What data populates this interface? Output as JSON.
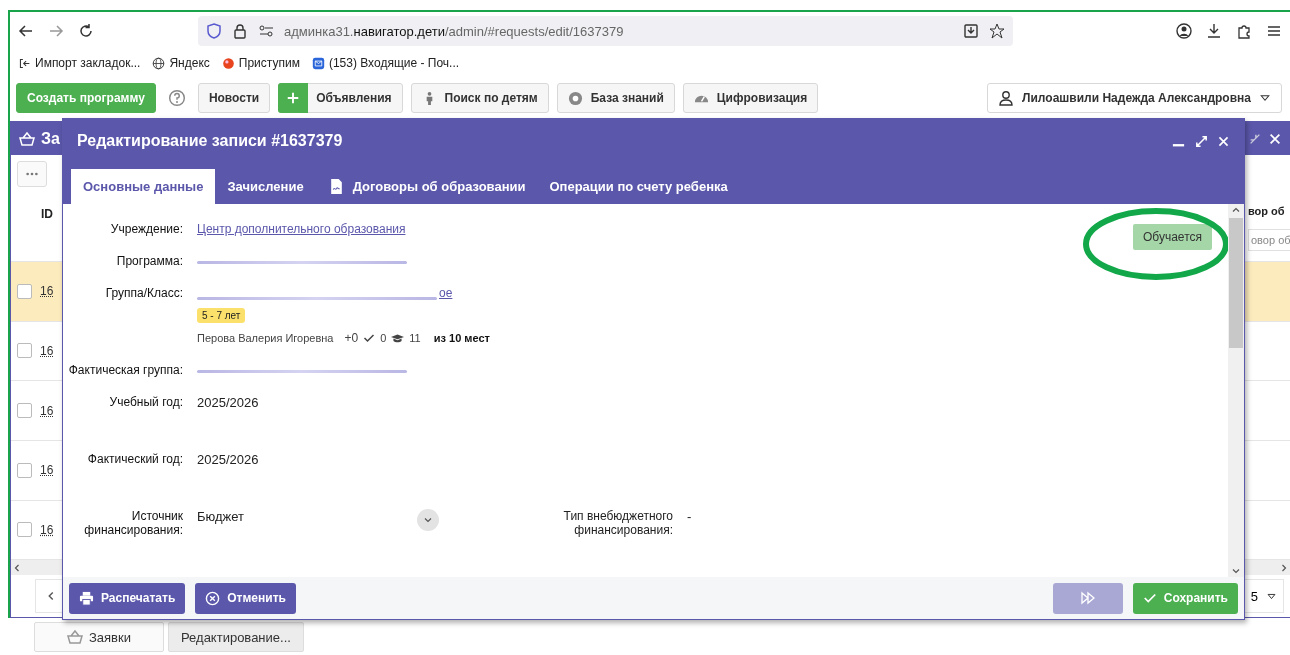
{
  "browser": {
    "url": "админка31.**навигатор.дети**/admin/#requests/edit/1637379",
    "bookmarks": [
      {
        "label": "Импорт закладок...",
        "kind": "import"
      },
      {
        "label": "Яндекс",
        "kind": "globe"
      },
      {
        "label": "Приступим",
        "kind": "dot"
      },
      {
        "label": "(153) Входящие - Поч...",
        "kind": "mail"
      }
    ]
  },
  "toolbar": {
    "buttons": [
      {
        "label": "Создать программу",
        "kind": "primary"
      },
      {
        "kind": "help"
      },
      {
        "label": "Новости",
        "kind": "plain"
      },
      {
        "label": "Объявления",
        "kind": "plus"
      },
      {
        "label": "Поиск по детям",
        "kind": "person"
      },
      {
        "label": "База знаний",
        "kind": "lifebuoy"
      },
      {
        "label": "Цифровизация",
        "kind": "gauge"
      }
    ],
    "user": "Лилоашвили Надежда Александровна"
  },
  "background_window": {
    "title": "За",
    "id_header": "ID",
    "column_header": "вор об",
    "filter_placeholder": "овор об",
    "page_size": "5",
    "rows": [
      {
        "id": "16",
        "selected": true
      },
      {
        "id": "16",
        "selected": false
      },
      {
        "id": "16",
        "selected": false
      },
      {
        "id": "16",
        "selected": false
      },
      {
        "id": "16",
        "selected": false
      }
    ]
  },
  "modal": {
    "title": "Редактирование записи #1637379",
    "tabs": [
      {
        "label": "Основные данные",
        "selected": true,
        "kind": "plain"
      },
      {
        "label": "Зачисление",
        "selected": false,
        "kind": "plain"
      },
      {
        "label": "Договоры об образовании",
        "selected": false,
        "kind": "document"
      },
      {
        "label": "Операции по счету ребенка",
        "selected": false,
        "kind": "plain"
      }
    ],
    "status": "Обучается",
    "fields": [
      {
        "kind": "link",
        "label": "Учреждение:",
        "value": "Центр дополнительного образования"
      },
      {
        "kind": "redacted",
        "label": "Программа:"
      },
      {
        "kind": "group",
        "label": "Группа/Класс:",
        "value_tail": "ое",
        "age": "5 - 7 лет",
        "teacher": "Перова Валерия Игоревна",
        "added": "+0",
        "confirmed": "0",
        "enrolled": "11",
        "capacity": "из 10 мест"
      },
      {
        "kind": "redacted_link",
        "label": "Фактическая группа:"
      },
      {
        "kind": "value",
        "label": "Учебный год:",
        "value": "2025/2026"
      },
      {
        "kind": "value",
        "label": "Фактический год:",
        "value": "2025/2026"
      },
      {
        "kind": "pair",
        "label": "Источник финансирования:",
        "value": "Бюджет",
        "label2": "Тип внебюджетного финансирования:",
        "value2": "-"
      }
    ],
    "footer": [
      {
        "label": "Распечатать",
        "kind": "print",
        "disabled": false
      },
      {
        "label": "Отменить",
        "kind": "cancel",
        "disabled": false
      },
      {
        "kind": "forward",
        "disabled": true
      },
      {
        "label": "Сохранить",
        "kind": "save",
        "disabled": false
      }
    ]
  },
  "taskbar": [
    {
      "label": "Заявки",
      "selected": false,
      "kind": "basket"
    },
    {
      "label": "Редактирование...",
      "selected": true,
      "kind": "plain"
    }
  ]
}
